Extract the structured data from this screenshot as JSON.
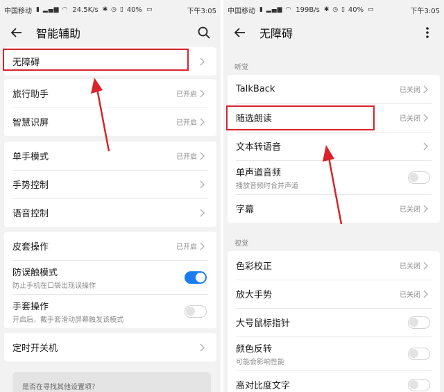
{
  "colors": {
    "accent": "#1b7cf2",
    "annotation_red": "#d8232a",
    "background": "#f2f2f2"
  },
  "left": {
    "status_bar": {
      "carrier": "中国移动",
      "speed": "24.5K/s",
      "battery": "40%",
      "time": "下午3:05"
    },
    "header": {
      "title": "智能辅助",
      "back_icon": "arrow-left-icon",
      "action_icon": "search-icon"
    },
    "rows": [
      {
        "label": "无障碍",
        "status": "",
        "highlighted": true
      },
      {
        "label": "旅行助手",
        "status": "已开启"
      },
      {
        "label": "智慧识屏",
        "status": "已开启"
      },
      {
        "label": "单手模式",
        "status": "已开启"
      },
      {
        "label": "手势控制",
        "status": ""
      },
      {
        "label": "语音控制",
        "status": ""
      },
      {
        "label": "皮套操作",
        "status": "已开启"
      },
      {
        "label": "防误触模式",
        "sub": "防止手机在口袋出现误操作",
        "toggle": "on"
      },
      {
        "label": "手套操作",
        "sub": "开启后，戴手套滑动屏幕触发该模式",
        "toggle": "off"
      },
      {
        "label": "定时开关机",
        "status": ""
      }
    ],
    "hint": "是否在寻找其他设置项？"
  },
  "right": {
    "status_bar": {
      "carrier": "中国移动",
      "speed": "199B/s",
      "battery": "40%",
      "time": "下午3:05"
    },
    "header": {
      "title": "无障碍",
      "back_icon": "arrow-left-icon",
      "action_icon": "more-vertical-icon"
    },
    "section_hearing": "听觉",
    "hearing_rows": [
      {
        "label": "TalkBack",
        "status": "已关闭"
      },
      {
        "label": "随选朗读",
        "status": "已关闭",
        "highlighted": true
      },
      {
        "label": "文本转语音",
        "status": ""
      },
      {
        "label": "单声道音频",
        "sub": "播放音频时合并声道",
        "toggle": "off"
      },
      {
        "label": "字幕",
        "status": "已关闭"
      }
    ],
    "section_vision": "视觉",
    "vision_rows": [
      {
        "label": "色彩校正",
        "status": "已关闭"
      },
      {
        "label": "放大手势",
        "status": "已关闭"
      },
      {
        "label": "大号鼠标指针",
        "toggle": "off"
      },
      {
        "label": "颜色反转",
        "sub": "可能会影响性能",
        "toggle": "off"
      },
      {
        "label": "高对比度文字",
        "toggle": "off"
      }
    ]
  }
}
